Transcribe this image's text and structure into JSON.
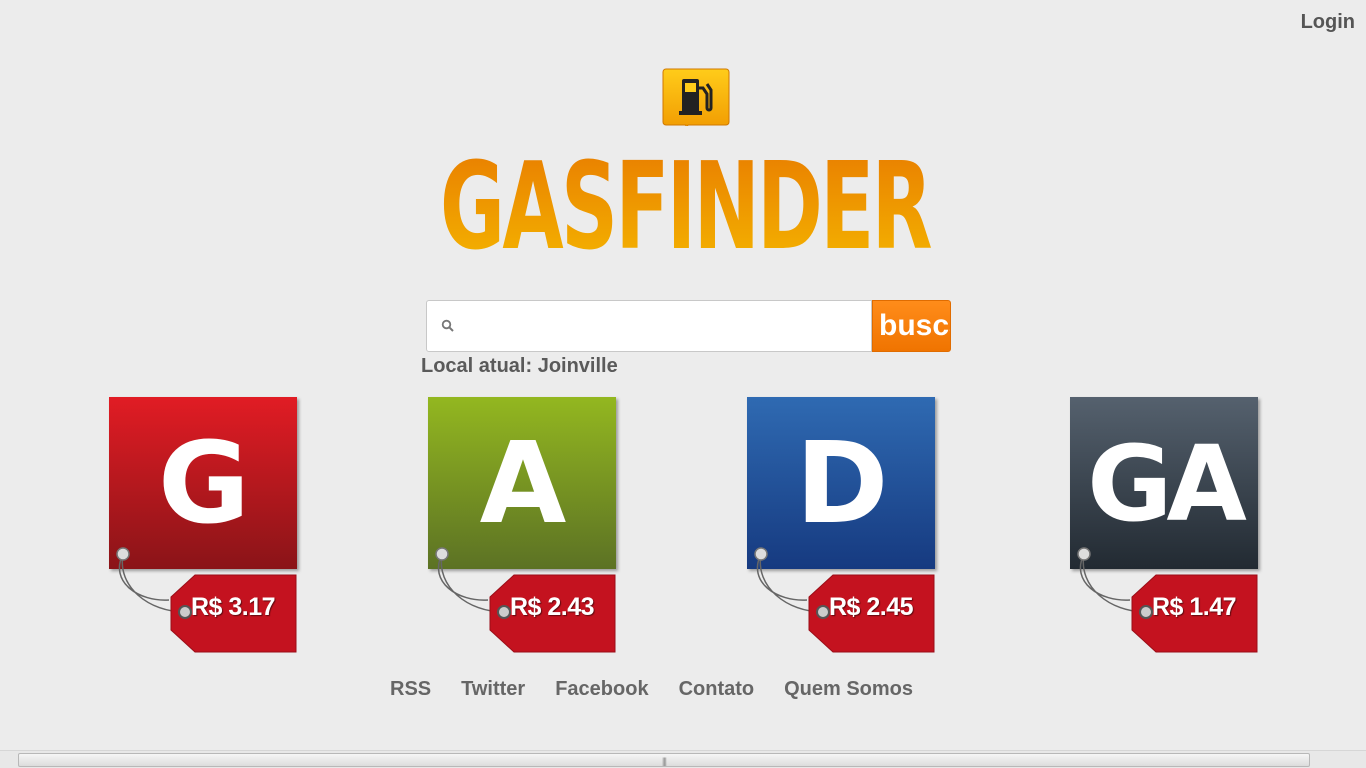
{
  "header": {
    "login_label": "Login"
  },
  "brand": {
    "name": "GASFINDER",
    "logo_icon": "gas-pump-icon"
  },
  "search": {
    "placeholder": "",
    "value": "",
    "button_label": "busca"
  },
  "location": {
    "text": "Local atual: Joinville"
  },
  "fuels": [
    {
      "letter": "G",
      "price": "R$ 3.17",
      "color_top": "#e11c24",
      "color_bottom": "#8a1418"
    },
    {
      "letter": "A",
      "price": "R$ 2.43",
      "color_top": "#93b720",
      "color_bottom": "#5c7224"
    },
    {
      "letter": "D",
      "price": "R$ 2.45",
      "color_top": "#2f6ab2",
      "color_bottom": "#163a80"
    },
    {
      "letter": "GA",
      "price": "R$ 1.47",
      "color_top": "#55616e",
      "color_bottom": "#222a32"
    }
  ],
  "footer_links": [
    "RSS",
    "Twitter",
    "Facebook",
    "Contato",
    "Quem Somos"
  ],
  "colors": {
    "accent": "#f07a00",
    "tag_red": "#c4121f"
  }
}
